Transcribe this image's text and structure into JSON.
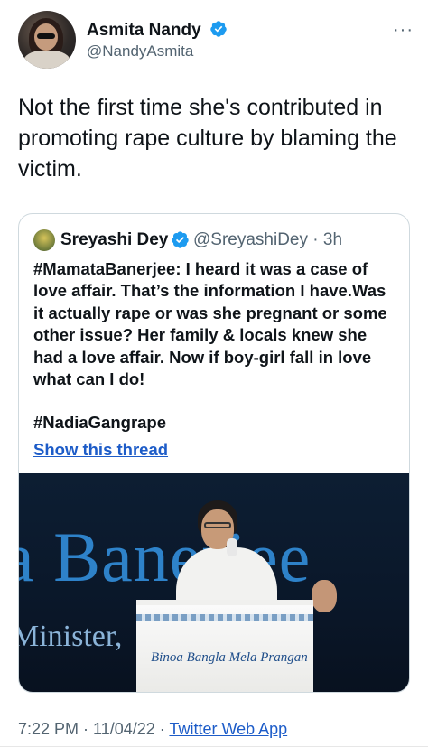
{
  "author": {
    "name": "Asmita Nandy",
    "handle": "@NandyAsmita",
    "verified_icon": "verified-badge-icon",
    "more_label": "···"
  },
  "tweet": {
    "text": "Not the first time she's contributed in promoting rape culture by blaming the victim."
  },
  "quote": {
    "name": "Sreyashi Dey",
    "handle_time": "@SreyashiDey · 3h",
    "body": "#MamataBanerjee: I heard it was a case of love affair. That’s the information I have.Was it actually rape or was she pregnant or some other issue? Her family & locals knew she had a love affair. Now if boy-girl fall in love what can I do!",
    "hashtag": "#NadiaGangrape",
    "show_thread": "Show this thread",
    "media": {
      "banner_text": "a Banerjee",
      "banner_subtext": "Minister,",
      "podium_text": "Binoa Bangla Mela Prangan"
    }
  },
  "meta": {
    "time_date": "7:22 PM · 11/04/22 · ",
    "app": "Twitter Web App"
  },
  "colors": {
    "verified": "#1d9bf0",
    "link": "#1d5cc8",
    "secondary_text": "#536471"
  }
}
